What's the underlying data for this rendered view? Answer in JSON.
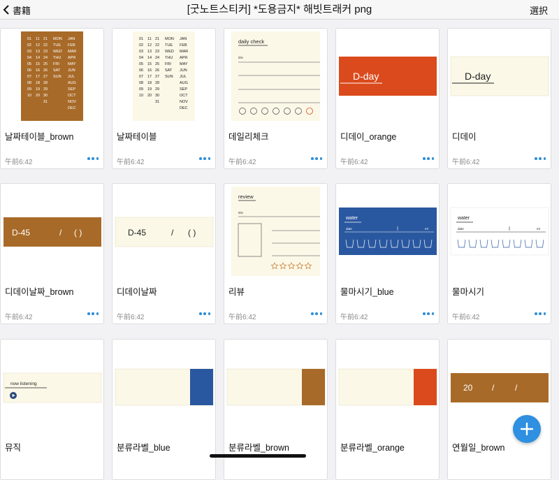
{
  "nav": {
    "back_label": "書籍",
    "title": "[굿노트스티커] *도용금지* 해빗트래커 png",
    "select_label": "選択"
  },
  "cards": [
    {
      "title": "날짜테이블_brown",
      "time": "午前6:42",
      "thumb": "date-table-brown"
    },
    {
      "title": "날짜테이블",
      "time": "午前6:42",
      "thumb": "date-table"
    },
    {
      "title": "데일리체크",
      "time": "午前6:42",
      "thumb": "daily-check"
    },
    {
      "title": "디데이_orange",
      "time": "午前6:42",
      "thumb": "dday-orange"
    },
    {
      "title": "디데이",
      "time": "午前6:42",
      "thumb": "dday"
    },
    {
      "title": "디데이날짜_brown",
      "time": "午前6:42",
      "thumb": "dday-date-brown"
    },
    {
      "title": "디데이날짜",
      "time": "午前6:42",
      "thumb": "dday-date"
    },
    {
      "title": "리뷰",
      "time": "午前6:42",
      "thumb": "review"
    },
    {
      "title": "물마시기_blue",
      "time": "午前6:42",
      "thumb": "water-blue"
    },
    {
      "title": "물마시기",
      "time": "午前6:42",
      "thumb": "water"
    },
    {
      "title": "뮤직",
      "time": "",
      "thumb": "music"
    },
    {
      "title": "분류라벨_blue",
      "time": "",
      "thumb": "label-blue"
    },
    {
      "title": "분류라벨_brown",
      "time": "",
      "thumb": "label-brown"
    },
    {
      "title": "분류라벨_orange",
      "time": "",
      "thumb": "label-orange"
    },
    {
      "title": "연월일_brown",
      "time": "",
      "thumb": "ymd-brown"
    }
  ],
  "stickers": {
    "date_table": {
      "days": [
        "01",
        "02",
        "03",
        "04",
        "05",
        "06",
        "07",
        "08",
        "09",
        "10"
      ],
      "days2": [
        "11",
        "12",
        "13",
        "14",
        "15",
        "16",
        "17",
        "18",
        "19",
        "20"
      ],
      "days3": [
        "21",
        "22",
        "23",
        "24",
        "25",
        "26",
        "27",
        "28",
        "29",
        "30",
        "31"
      ],
      "weekdays": [
        "MON",
        "TUE",
        "WED",
        "THU",
        "FRI",
        "SAT",
        "SUN"
      ],
      "months": [
        "JAN",
        "FEB",
        "MAR",
        "APR",
        "MAY",
        "JUN",
        "JUL",
        "AUG",
        "SEP",
        "OCT",
        "NOV",
        "DEC"
      ]
    },
    "daily_check": {
      "heading": "daily check",
      "field": "title"
    },
    "dday": {
      "label": "D-day"
    },
    "dday_date": {
      "label": "D-45",
      "slash": "/",
      "paren": "(   )"
    },
    "review": {
      "heading": "review",
      "field": "title"
    },
    "water": {
      "heading": "water",
      "date": "date",
      "unit": "ml"
    },
    "music": {
      "heading": "now listening"
    },
    "ymd": {
      "label": "20",
      "slash1": "/",
      "slash2": "/"
    }
  },
  "colors": {
    "brown": "#a86a28",
    "orange": "#db4a1c",
    "blue": "#2a58a0",
    "cream": "#fbf8e8",
    "accent_blue": "#2f8fe0"
  },
  "icons": {
    "back": "chevron-left-icon",
    "more": "ellipsis-icon",
    "fab": "plus-icon",
    "play": "play-icon"
  }
}
